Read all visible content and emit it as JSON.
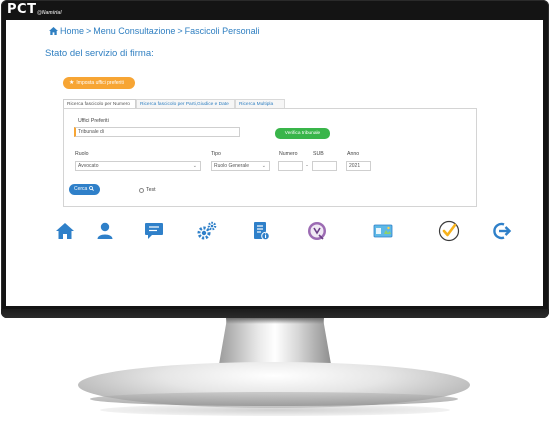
{
  "bezel": {
    "logo": "PCT",
    "logo_sub": "@Namirial"
  },
  "breadcrumb": {
    "items": [
      "Home",
      "Menu Consultazione",
      "Fascicoli Personali"
    ],
    "separator": ">"
  },
  "page": {
    "title": "Stato del servizio di firma:"
  },
  "favorites_button": {
    "label": "Imposta uffici preferiti",
    "color": "#f7a534"
  },
  "tabs": [
    {
      "label": "Ricerca fascicolo per Numero",
      "active": true
    },
    {
      "label": "Ricerca fascicolo per Parti,Giudice e Date",
      "active": false
    },
    {
      "label": "Ricerca Multipla",
      "active": false
    }
  ],
  "form": {
    "uffici_label": "Uffici Preferiti",
    "uffici_value": "Tribunale di",
    "verify_label": "Verifica tribunale",
    "ruolo_label": "Ruolo",
    "ruolo_value": "Avvocato",
    "tipo_label": "Tipo",
    "tipo_value": "Ruolo Generale",
    "numero_label": "Numero",
    "numero_value": "",
    "sub_label": "SUB",
    "sub_value": "",
    "sub_separator": "-",
    "anno_label": "Anno",
    "anno_value": "2021",
    "cerca_label": "Cerca",
    "test_label": "Test",
    "test_checked": false
  },
  "iconbar": [
    {
      "icon": "home-icon"
    },
    {
      "icon": "user-icon"
    },
    {
      "icon": "chat-icon"
    },
    {
      "icon": "gears-icon"
    },
    {
      "icon": "document-info-icon"
    },
    {
      "icon": "namirial-badge-icon"
    },
    {
      "icon": "id-card-icon"
    },
    {
      "icon": "checkmark-icon"
    },
    {
      "icon": "logout-icon"
    }
  ],
  "colors": {
    "primary_blue": "#2f80c9",
    "link_blue": "#2f7fc1",
    "orange": "#f7a534",
    "green": "#39b54a"
  }
}
